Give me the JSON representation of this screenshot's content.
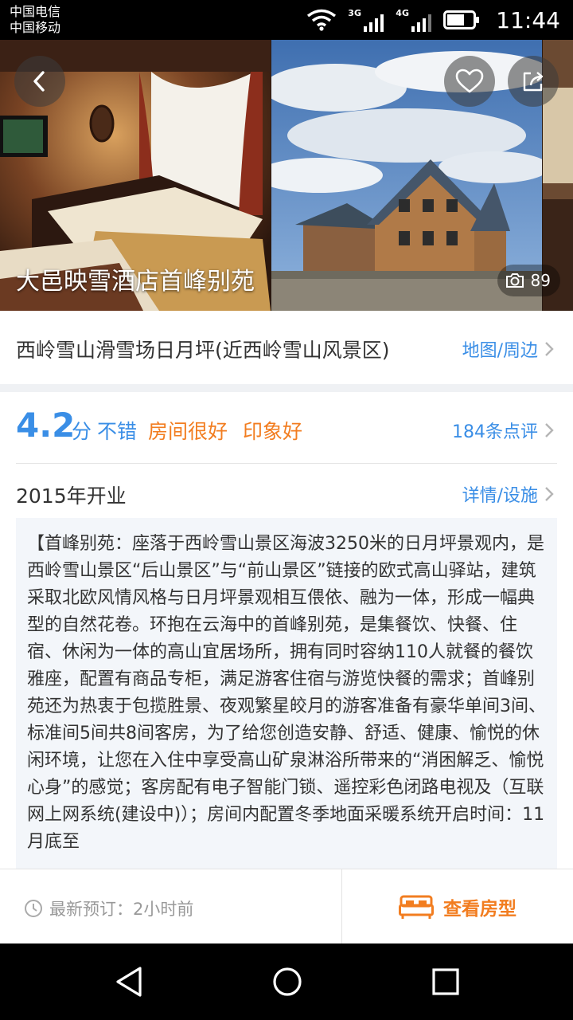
{
  "status_bar": {
    "carrier_1": "中国电信",
    "carrier_2": "中国移动",
    "network_1": "3G",
    "network_2": "4G",
    "time": "11:44"
  },
  "hero": {
    "hotel_name": "大邑映雪酒店首峰别苑",
    "photo_count": "89",
    "icons": [
      "back-arrow-icon",
      "heart-icon",
      "share-icon",
      "camera-icon"
    ]
  },
  "location": {
    "address": "西岭雪山滑雪场日月坪(近西岭雪山风景区)",
    "map_link": "地图/周边"
  },
  "rating": {
    "score": "4.2",
    "unit": "分",
    "word": "不错",
    "tag_1": "房间很好",
    "tag_2": "印象好",
    "reviews_link": "184条点评"
  },
  "info": {
    "opened": "2015年开业",
    "details_link": "详情/设施",
    "description": "【首峰别苑：座落于西岭雪山景区海波3250米的日月坪景观内，是西岭雪山景区“后山景区”与“前山景区”链接的欧式高山驿站，建筑采取北欧风情风格与日月坪景观相互偎依、融为一体，形成一幅典型的自然花卷。环抱在云海中的首峰别苑，是集餐饮、快餐、住宿、休闲为一体的高山宜居场所，拥有同时容纳110人就餐的餐饮雅座，配置有商品专柜，满足游客住宿与游览快餐的需求；首峰别苑还为热衷于包揽胜景、夜观繁星皎月的游客准备有豪华单间3间、标准间5间共8间客房，为了给您创造安静、舒适、健康、愉悦的休闲环境，让您在入住中享受高山矿泉淋浴所带来的“消困解乏、愉悦心身”的感觉；客房配有电子智能门锁、遥控彩色闭路电视及（互联网上网系统(建设中)）；房间内配置冬季地面采暖系统开启时间：11月底至"
  },
  "bottom": {
    "latest_booking": "最新预订：2小时前",
    "view_rooms": "查看房型"
  },
  "colors": {
    "accent_blue": "#3a8ee6",
    "accent_orange": "#f27d20"
  }
}
